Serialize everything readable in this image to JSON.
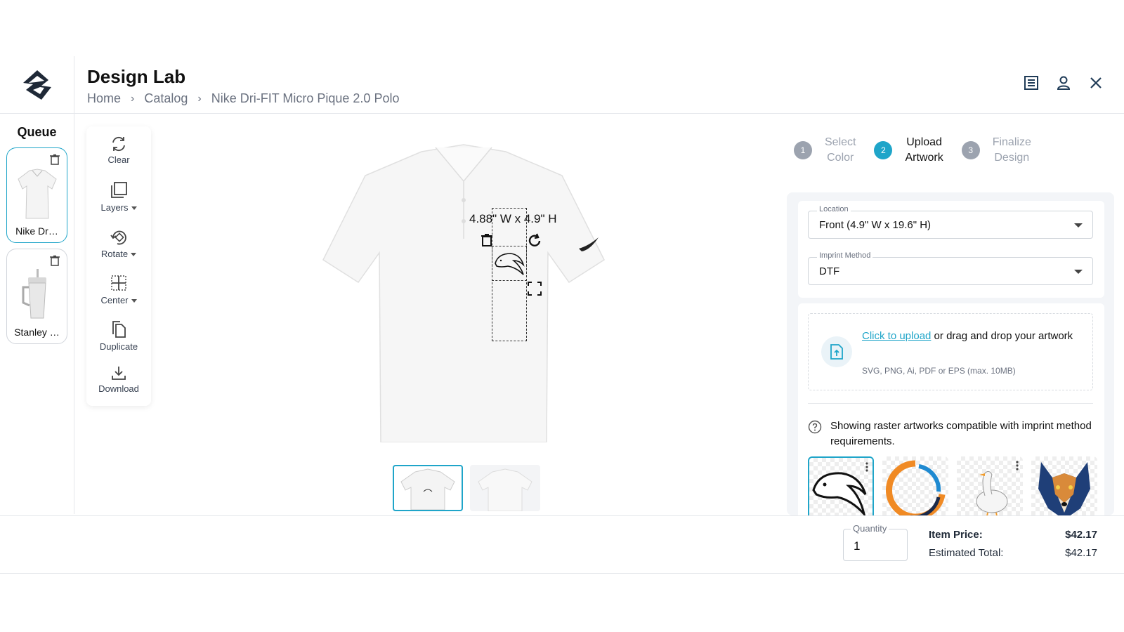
{
  "header": {
    "title": "Design Lab",
    "breadcrumb": [
      "Home",
      "Catalog",
      "Nike Dri-FIT Micro Pique 2.0 Polo"
    ],
    "icons": [
      "list-icon",
      "user-icon",
      "close-icon"
    ]
  },
  "queue": {
    "title": "Queue",
    "items": [
      {
        "name": "Nike Dr…",
        "icon": "polo-thumbnail"
      },
      {
        "name": "Stanley …",
        "icon": "tumbler-thumbnail"
      }
    ]
  },
  "tools": {
    "clear": "Clear",
    "layers": "Layers",
    "rotate": "Rotate",
    "center": "Center",
    "duplicate": "Duplicate",
    "download": "Download"
  },
  "canvas": {
    "dimensions": "4.88\" W x 4.9\" H"
  },
  "steps": [
    {
      "number": "1",
      "line1": "Select",
      "line2": "Color"
    },
    {
      "number": "2",
      "line1": "Upload",
      "line2": "Artwork"
    },
    {
      "number": "3",
      "line1": "Finalize",
      "line2": "Design"
    }
  ],
  "form": {
    "location_label": "Location",
    "location_value": "Front (4.9\" W x 19.6\" H)",
    "imprint_label": "Imprint Method",
    "imprint_value": "DTF"
  },
  "upload": {
    "link": "Click to upload",
    "text": " or drag and drop your artwork",
    "hint": "SVG, PNG, Ai, PDF or EPS (max. 10MB)"
  },
  "info": "Showing raster artworks compatible with imprint method requirements.",
  "footer": {
    "quantity_label": "Quantity",
    "quantity_value": "1",
    "item_price_label": "Item Price:",
    "item_price": "$42.17",
    "estimated_total_label": "Estimated Total:",
    "estimated_total": "$42.17"
  },
  "colors": {
    "accent": "#1fa5c9",
    "muted": "#9ca3af"
  }
}
